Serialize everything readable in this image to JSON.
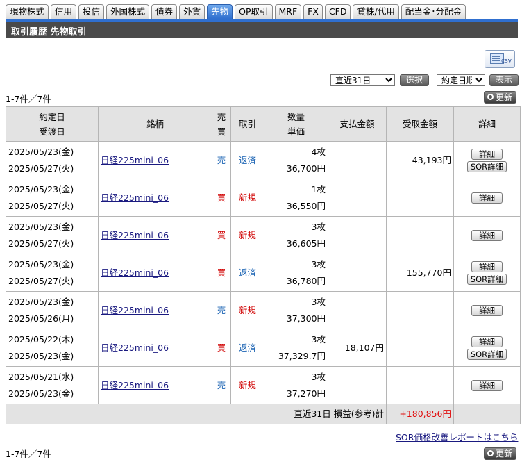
{
  "tabs": [
    {
      "label": "現物株式",
      "active": false
    },
    {
      "label": "信用",
      "active": false
    },
    {
      "label": "投信",
      "active": false
    },
    {
      "label": "外国株式",
      "active": false
    },
    {
      "label": "債券",
      "active": false
    },
    {
      "label": "外貨",
      "active": false
    },
    {
      "label": "先物",
      "active": true
    },
    {
      "label": "OP取引",
      "active": false
    },
    {
      "label": "MRF",
      "active": false
    },
    {
      "label": "FX",
      "active": false
    },
    {
      "label": "CFD",
      "active": false
    },
    {
      "label": "貸株/代用",
      "active": false
    },
    {
      "label": "配当金･分配金",
      "active": false
    }
  ],
  "page_title": "取引履歴 先物取引",
  "csv_label": "csv",
  "filters": {
    "period_value": "直近31日",
    "select_label": "選択",
    "sort_value": "約定日順",
    "display_label": "表示"
  },
  "count_text": "1-7件／7件",
  "refresh_label": "更新",
  "table": {
    "headers": {
      "date1": "約定日",
      "date2": "受渡日",
      "issue": "銘柄",
      "side1": "売",
      "side2": "買",
      "trade": "取引",
      "qty1": "数量",
      "qty2": "単価",
      "pay": "支払金額",
      "receive": "受取金額",
      "detail": "詳細"
    },
    "rows": [
      {
        "trade_date": "2025/05/23(金)",
        "settle_date": "2025/05/27(火)",
        "issue": "日経225mini_06",
        "side": "売",
        "type": "返済",
        "qty": "4枚",
        "price": "36,700円",
        "pay": "",
        "receive": "43,193円",
        "sor": true
      },
      {
        "trade_date": "2025/05/23(金)",
        "settle_date": "2025/05/27(火)",
        "issue": "日経225mini_06",
        "side": "買",
        "type": "新規",
        "qty": "1枚",
        "price": "36,550円",
        "pay": "",
        "receive": "",
        "sor": false
      },
      {
        "trade_date": "2025/05/23(金)",
        "settle_date": "2025/05/27(火)",
        "issue": "日経225mini_06",
        "side": "買",
        "type": "新規",
        "qty": "3枚",
        "price": "36,605円",
        "pay": "",
        "receive": "",
        "sor": false
      },
      {
        "trade_date": "2025/05/23(金)",
        "settle_date": "2025/05/27(火)",
        "issue": "日経225mini_06",
        "side": "買",
        "type": "返済",
        "qty": "3枚",
        "price": "36,780円",
        "pay": "",
        "receive": "155,770円",
        "sor": true
      },
      {
        "trade_date": "2025/05/23(金)",
        "settle_date": "2025/05/26(月)",
        "issue": "日経225mini_06",
        "side": "売",
        "type": "新規",
        "qty": "3枚",
        "price": "37,300円",
        "pay": "",
        "receive": "",
        "sor": false
      },
      {
        "trade_date": "2025/05/22(木)",
        "settle_date": "2025/05/23(金)",
        "issue": "日経225mini_06",
        "side": "買",
        "type": "返済",
        "qty": "3枚",
        "price": "37,329.7円",
        "pay": "18,107円",
        "receive": "",
        "sor": true
      },
      {
        "trade_date": "2025/05/21(水)",
        "settle_date": "2025/05/23(金)",
        "issue": "日経225mini_06",
        "side": "売",
        "type": "新規",
        "qty": "3枚",
        "price": "37,270円",
        "pay": "",
        "receive": "",
        "sor": false
      }
    ],
    "detail_label": "詳細",
    "sor_detail_label": "SOR詳細",
    "total_label": "直近31日 損益(参考)計",
    "total_value": "+180,856円"
  },
  "report_link": "SOR価格改善レポートはこちら",
  "colors": {
    "buy": "#d00000",
    "sell": "#1c64b4",
    "active_tab": "#2f6fcf",
    "title_bar": "#4a4a4a"
  }
}
